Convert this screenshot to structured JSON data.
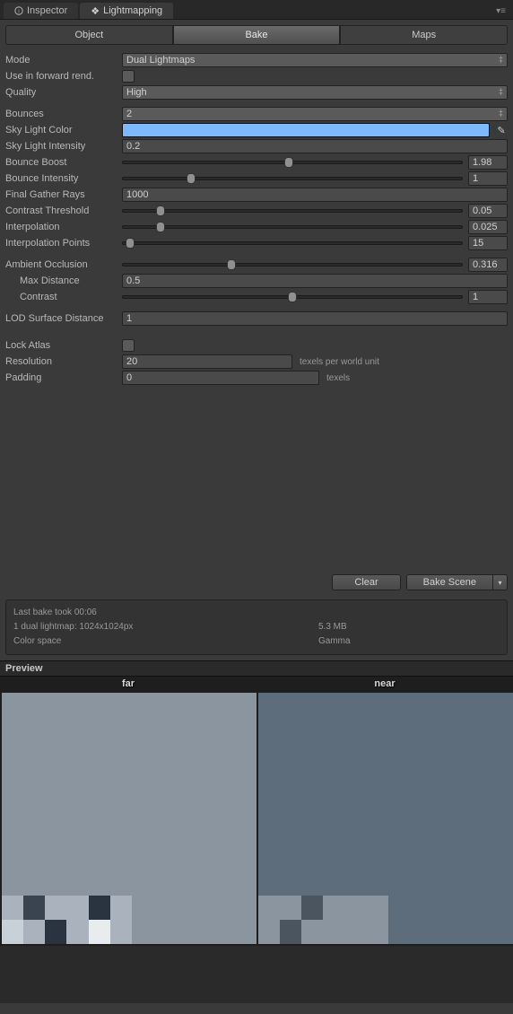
{
  "tabs": {
    "inspector": "Inspector",
    "lightmapping": "Lightmapping"
  },
  "mainTabs": {
    "object": "Object",
    "bake": "Bake",
    "maps": "Maps"
  },
  "labels": {
    "mode": "Mode",
    "forward": "Use in forward rend.",
    "quality": "Quality",
    "bounces": "Bounces",
    "skyColor": "Sky Light Color",
    "skyIntensity": "Sky Light Intensity",
    "bounceBoost": "Bounce Boost",
    "bounceIntensity": "Bounce Intensity",
    "finalGather": "Final Gather Rays",
    "contrastThreshold": "Contrast Threshold",
    "interpolation": "Interpolation",
    "interpPoints": "Interpolation Points",
    "ao": "Ambient Occlusion",
    "maxDist": "Max Distance",
    "contrast": "Contrast",
    "lod": "LOD Surface Distance",
    "lockAtlas": "Lock Atlas",
    "resolution": "Resolution",
    "padding": "Padding"
  },
  "values": {
    "mode": "Dual Lightmaps",
    "quality": "High",
    "bounces": "2",
    "skyColor": "#7db9ff",
    "skyIntensity": "0.2",
    "bounceBoost": "1.98",
    "bounceIntensity": "1",
    "finalGather": "1000",
    "contrastThreshold": "0.05",
    "interpolation": "0.025",
    "interpPoints": "15",
    "ao": "0.316",
    "maxDist": "0.5",
    "contrast": "1",
    "lod": "1",
    "resolution": "20",
    "padding": "0"
  },
  "hints": {
    "resolution": "texels per world unit",
    "padding": "texels"
  },
  "buttons": {
    "clear": "Clear",
    "bakeScene": "Bake Scene"
  },
  "status": {
    "lastBake": "Last bake took 00:06",
    "lightmap": "1 dual lightmap: 1024x1024px",
    "size": "5.3 MB",
    "colorspaceLabel": "Color space",
    "colorspace": "Gamma"
  },
  "preview": {
    "header": "Preview",
    "far": "far",
    "near": "near"
  },
  "sliders": {
    "bounceBoost": 49,
    "bounceIntensity": 20,
    "contrastThreshold": 11,
    "interpolation": 11,
    "interpPoints": 2,
    "ao": 32,
    "contrast": 50
  }
}
